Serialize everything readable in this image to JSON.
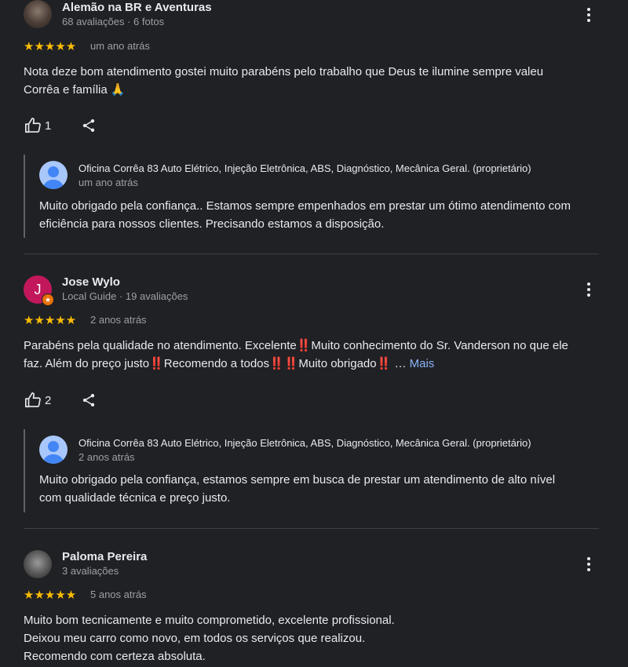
{
  "reviews": [
    {
      "name": "Alemão na BR e Aventuras",
      "meta": "68 avaliações · 6 fotos",
      "stars": "★★★★★",
      "when": "um ano atrás",
      "text_line1": "Nota deze bom atendimento gostei muito parabéns pelo trabalho que Deus te ilumine sempre valeu",
      "text_line2": "Corrêa e família 🙏",
      "likes": "1",
      "reply": {
        "owner": "Oficina Corrêa 83 Auto Elétrico, Injeção Eletrônica, ABS, Diagnóstico, Mecânica Geral. (proprietário)",
        "when": "um ano atrás",
        "text_line1": "Muito obrigado pela confiança.. Estamos sempre empenhados em prestar um ótimo atendimento com",
        "text_line2": "eficiência para nossos clientes. Precisando estamos a disposição."
      }
    },
    {
      "name": "Jose Wylo",
      "avatar_letter": "J",
      "meta": "Local Guide · 19 avaliações",
      "stars": "★★★★★",
      "when": "2 anos atrás",
      "text_line1": "Parabéns pela qualidade no atendimento. Excelente‼️Muito conhecimento do Sr. Vanderson no que ele",
      "text_line2": "faz. Além do preço justo‼️Recomendo a todos‼️‼️Muito obrigado‼️ …",
      "more_label": "Mais",
      "likes": "2",
      "reply": {
        "owner": "Oficina Corrêa 83 Auto Elétrico, Injeção Eletrônica, ABS, Diagnóstico, Mecânica Geral. (proprietário)",
        "when": "2 anos atrás",
        "text_line1": "Muito obrigado pela confiança, estamos sempre em busca de prestar um atendimento de alto nível",
        "text_line2": "com qualidade técnica e preço justo."
      }
    },
    {
      "name": "Paloma Pereira",
      "meta": "3 avaliações",
      "stars": "★★★★★",
      "when": "5 anos atrás",
      "text_line1": "Muito bom tecnicamente e muito comprometido, excelente profissional.",
      "text_line2": "Deixou meu carro como novo, em todos os serviços que realizou.",
      "text_line3": "Recomendo com certeza absoluta."
    }
  ],
  "colors": {
    "background": "#202124",
    "star": "#fbbc04",
    "link": "#8ab4f8",
    "avatar_j": "#c2185b"
  },
  "icons": [
    "more-vert-icon",
    "thumb-up-icon",
    "share-icon",
    "local-guide-star-icon",
    "owner-avatar-icon"
  ]
}
